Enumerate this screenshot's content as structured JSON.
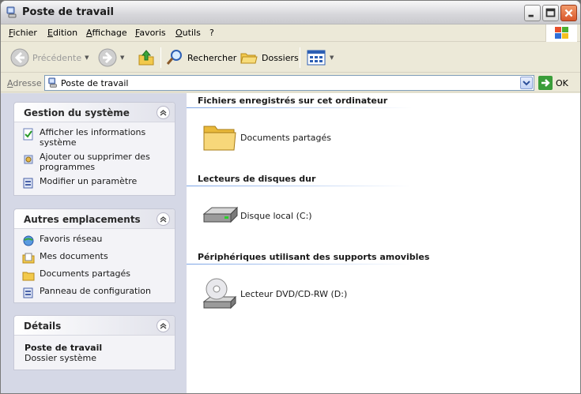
{
  "window": {
    "title": "Poste de travail"
  },
  "menu": [
    "Fichier",
    "Edition",
    "Affichage",
    "Favoris",
    "Outils",
    "?"
  ],
  "toolbar": {
    "back_label": "Précédente",
    "search_label": "Rechercher",
    "folders_label": "Dossiers"
  },
  "address": {
    "label": "Adresse",
    "value": "Poste de travail",
    "go_label": "OK"
  },
  "panels": {
    "system": {
      "title": "Gestion du système",
      "items": [
        "Afficher les informations système",
        "Ajouter ou supprimer des programmes",
        "Modifier un paramètre"
      ]
    },
    "places": {
      "title": "Autres emplacements",
      "items": [
        "Favoris réseau",
        "Mes documents",
        "Documents partagés",
        "Panneau de configuration"
      ]
    },
    "details": {
      "title": "Détails",
      "name": "Poste de travail",
      "type": "Dossier système"
    }
  },
  "groups": [
    {
      "title": "Fichiers enregistrés sur cet ordinateur",
      "items": [
        "Documents partagés"
      ]
    },
    {
      "title": "Lecteurs de disques dur",
      "items": [
        "Disque local (C:)"
      ]
    },
    {
      "title": "Périphériques utilisant des supports amovibles",
      "items": [
        "Lecteur DVD/CD-RW (D:)"
      ]
    }
  ]
}
